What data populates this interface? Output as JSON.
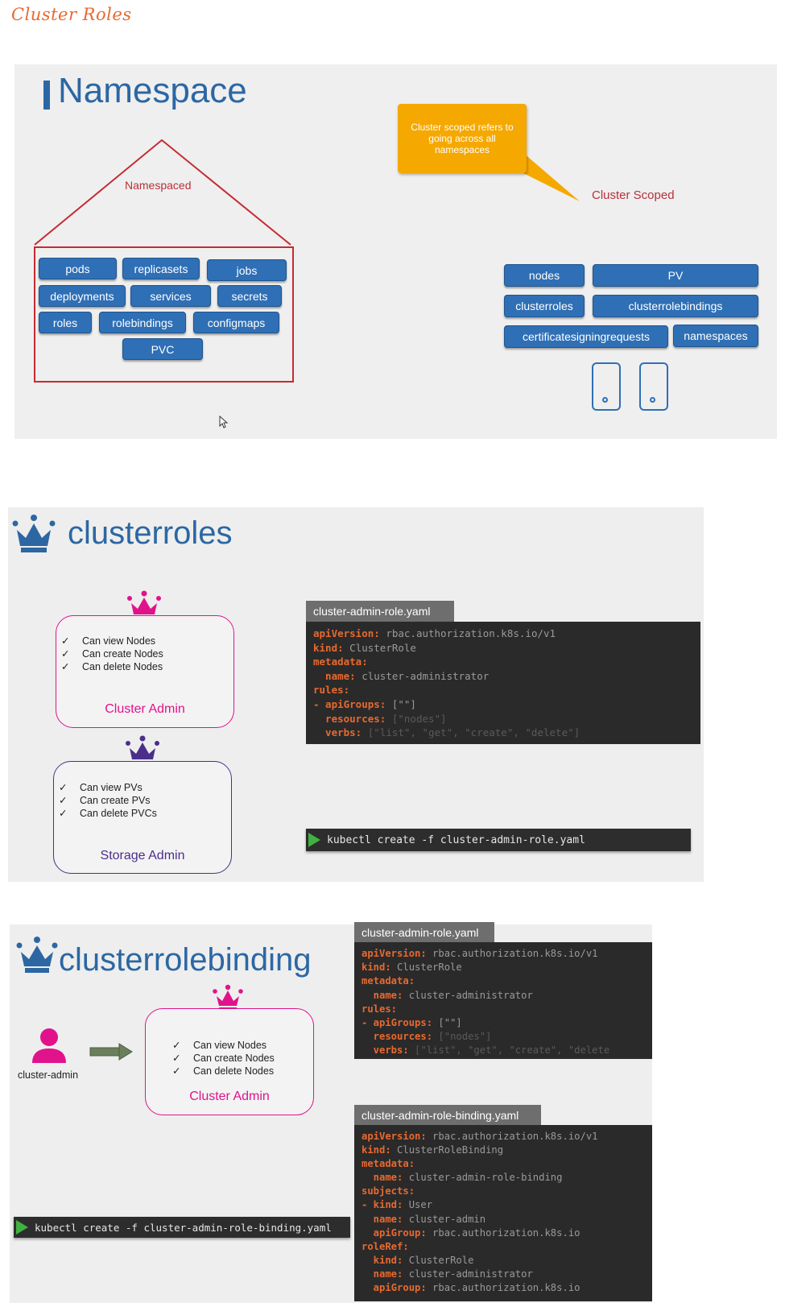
{
  "page_title": "Cluster Roles",
  "slide1": {
    "title": "Namespace",
    "namespaced_label": "Namespaced",
    "namespaced_resources": [
      "pods",
      "replicasets",
      "jobs",
      "deployments",
      "services",
      "secrets",
      "roles",
      "rolebindings",
      "configmaps",
      "PVC"
    ],
    "callout": "Cluster scoped refers to going across all namespaces",
    "cluster_scoped_label": "Cluster Scoped",
    "cluster_resources": [
      "nodes",
      "PV",
      "clusterroles",
      "clusterrolebindings",
      "certificatesigningrequests",
      "namespaces"
    ],
    "icons": [
      "house-outline-icon",
      "phone-icon",
      "phone-icon",
      "mouse-cursor-icon"
    ],
    "colors": {
      "accent": "#2c67a3",
      "pill": "#2f6fb5",
      "house": "#c42b33",
      "callout": "#f5a800"
    }
  },
  "slide2": {
    "title": "clusterroles",
    "cluster_admin": {
      "label": "Cluster Admin",
      "color": "#e0138c",
      "items": [
        "Can view Nodes",
        "Can create Nodes",
        "Can delete Nodes"
      ]
    },
    "storage_admin": {
      "label": "Storage Admin",
      "color": "#4b2e8c",
      "items": [
        "Can view PVs",
        "Can create PVs",
        "Can delete PVCs"
      ]
    },
    "check_mark": "✓",
    "file_name": "cluster-admin-role.yaml",
    "yaml": {
      "l1_key": "apiVersion:",
      "l1_val": " rbac.authorization.k8s.io/v1",
      "l2_key": "kind:",
      "l2_val": " ClusterRole",
      "l3_key": "metadata:",
      "l4_key": "  name:",
      "l4_val": " cluster-administrator",
      "l5_key": "rules:",
      "l6_key": "- apiGroups:",
      "l6_val": " [\"\"]",
      "l7_key": "  resources:",
      "l7_val": " [\"nodes\"]",
      "l8_key": "  verbs:",
      "l8_val": " [\"list\", \"get\", \"create\", \"delete\"]"
    },
    "command": "kubectl create -f cluster-admin-role.yaml"
  },
  "slide3": {
    "title": "clusterrolebinding",
    "user_label": "cluster-admin",
    "role_box": {
      "label": "Cluster Admin",
      "items": [
        "Can view Nodes",
        "Can create Nodes",
        "Can delete Nodes"
      ]
    },
    "file1_name": "cluster-admin-role.yaml",
    "yaml1": {
      "l1_key": "apiVersion:",
      "l1_val": " rbac.authorization.k8s.io/v1",
      "l2_key": "kind:",
      "l2_val": " ClusterRole",
      "l3_key": "metadata:",
      "l4_key": "  name:",
      "l4_val": " cluster-administrator",
      "l5_key": "rules:",
      "l6_key": "- apiGroups:",
      "l6_val": " [\"\"]",
      "l7_key": "  resources:",
      "l7_val": " [\"nodes\"]",
      "l8_key": "  verbs:",
      "l8_val": " [\"list\", \"get\", \"create\", \"delete"
    },
    "file2_name": "cluster-admin-role-binding.yaml",
    "yaml2": {
      "l1_key": "apiVersion:",
      "l1_val": " rbac.authorization.k8s.io/v1",
      "l2_key": "kind:",
      "l2_val": " ClusterRoleBinding",
      "l3_key": "metadata:",
      "l4_key": "  name:",
      "l4_val": " cluster-admin-role-binding",
      "l5_key": "subjects:",
      "l6_key": "- kind:",
      "l6_val": " User",
      "l7_key": "  name:",
      "l7_val": " cluster-admin",
      "l8_key": "  apiGroup:",
      "l8_val": " rbac.authorization.k8s.io",
      "l9_key": "roleRef:",
      "l10_key": "  kind:",
      "l10_val": " ClusterRole",
      "l11_key": "  name:",
      "l11_val": " cluster-administrator",
      "l12_key": "  apiGroup:",
      "l12_val": " rbac.authorization.k8s.io"
    },
    "command": "kubectl create -f cluster-admin-role-binding.yaml"
  }
}
